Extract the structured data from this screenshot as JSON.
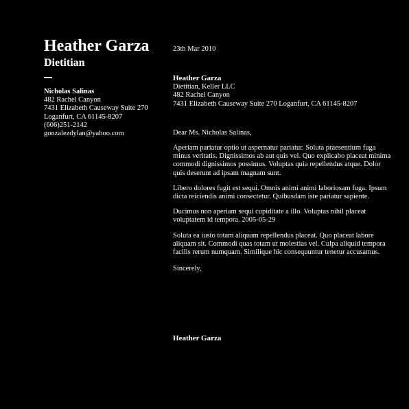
{
  "author": {
    "name": "Heather Garza",
    "title": "Dietitian"
  },
  "recipient": {
    "name": "Nicholas Salinas",
    "street": "482 Rachel Canyon",
    "address_line": "7431 Elizabeth Causeway Suite 270",
    "city_line": "Loganfurt, CA 61145-8207",
    "phone": "(606)251-2142",
    "email": "gonzalezdylan@yahoo.com"
  },
  "letter": {
    "date": "23th Mar 2010",
    "sender_name": "Heather Garza",
    "sender_company": "Dietitian, Keller LLC",
    "sender_street": "482 Rachel Canyon",
    "sender_address": "7431 Elizabeth Causeway Suite 270 Loganfurt, CA 61145-8207",
    "salutation": "Dear Ms. Nicholas Salinas,",
    "paragraphs": [
      "Aperiam pariatur optio ut aspernatur pariatur. Soluta praesentium fuga minus veritatis. Dignissimos ab aut quis vel. Quo explicabo placeat minima commodi dignissimos possimus. Voluptas quia repellendus atque. Dolor quis deserunt ad ipsam magnam sunt.",
      "Libero dolores fugit est sequi. Omnis animi animi laboriosam fuga. Ipsum dicta reiciendis animi consectetur. Quibusdam iste pariatur sapiente.",
      "Ducimus non aperiam sequi cupiditate a illo. Voluptas nihil placeat voluptatem id tempora. 2005-05-29",
      "Soluta ea iusto totam aliquam repellendus placeat. Quo placeat labore aliquam sit. Commodi quas totam ut molestias vel. Culpa aliquid tempora facilis rerum numquam. Similique hic consequuntur tenetur accusamus."
    ],
    "closing": "Sincerely,",
    "signature": "Heather Garza"
  },
  "colors": {
    "background": "#000000",
    "text": "#ffffff"
  }
}
